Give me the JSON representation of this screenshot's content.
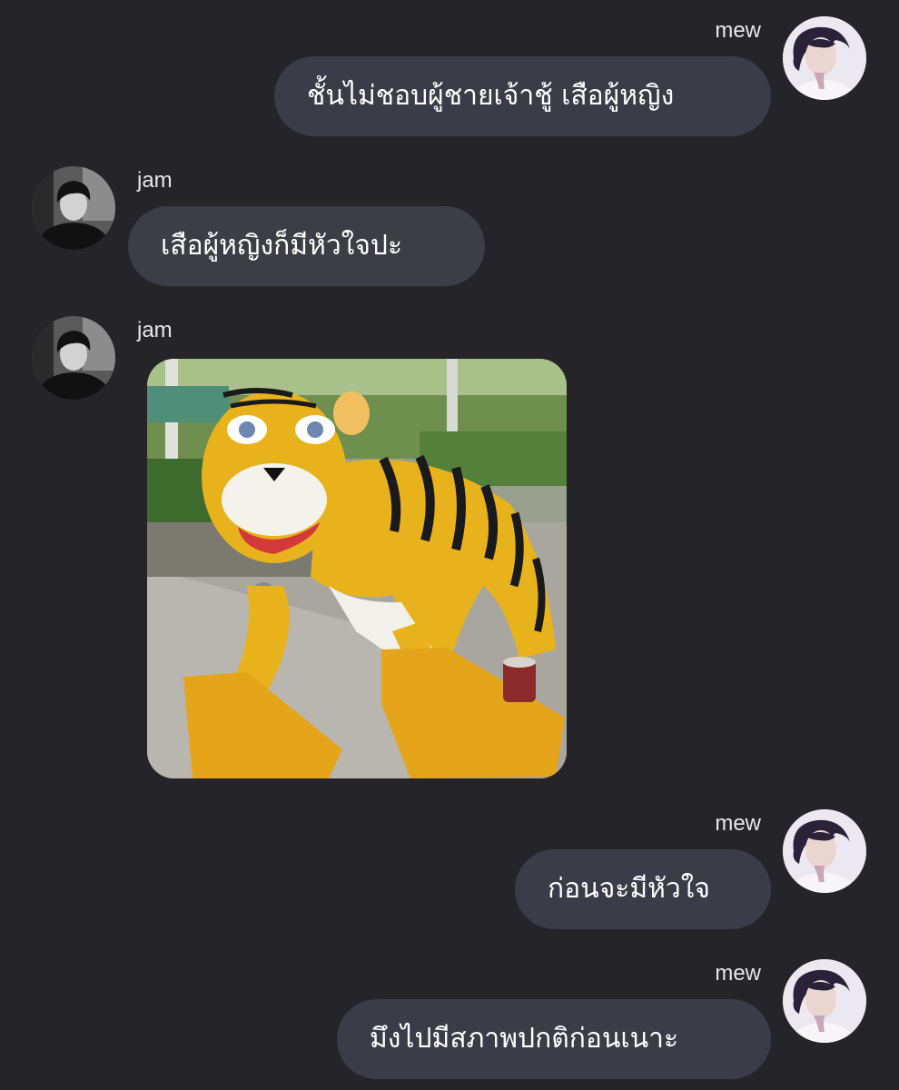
{
  "conversation": {
    "messages": [
      {
        "sender": "mew",
        "text": "ชั้นไม่ชอบผู้ชายเจ้าชู้ เสือผู้หญิง"
      },
      {
        "sender": "jam",
        "text": "เสือผู้หญิงก็มีหัวใจปะ"
      },
      {
        "sender": "jam",
        "image": "tiger-statue-photo"
      },
      {
        "sender": "mew",
        "text": "ก่อนจะมีหัวใจ"
      },
      {
        "sender": "mew",
        "text": "มึงไปมีสภาพปกติก่อนเนาะ"
      }
    ]
  },
  "colors": {
    "background": "#242429",
    "bubble": "#3a3d47",
    "text": "#ffffff",
    "sender_name": "#e8e8ec"
  }
}
